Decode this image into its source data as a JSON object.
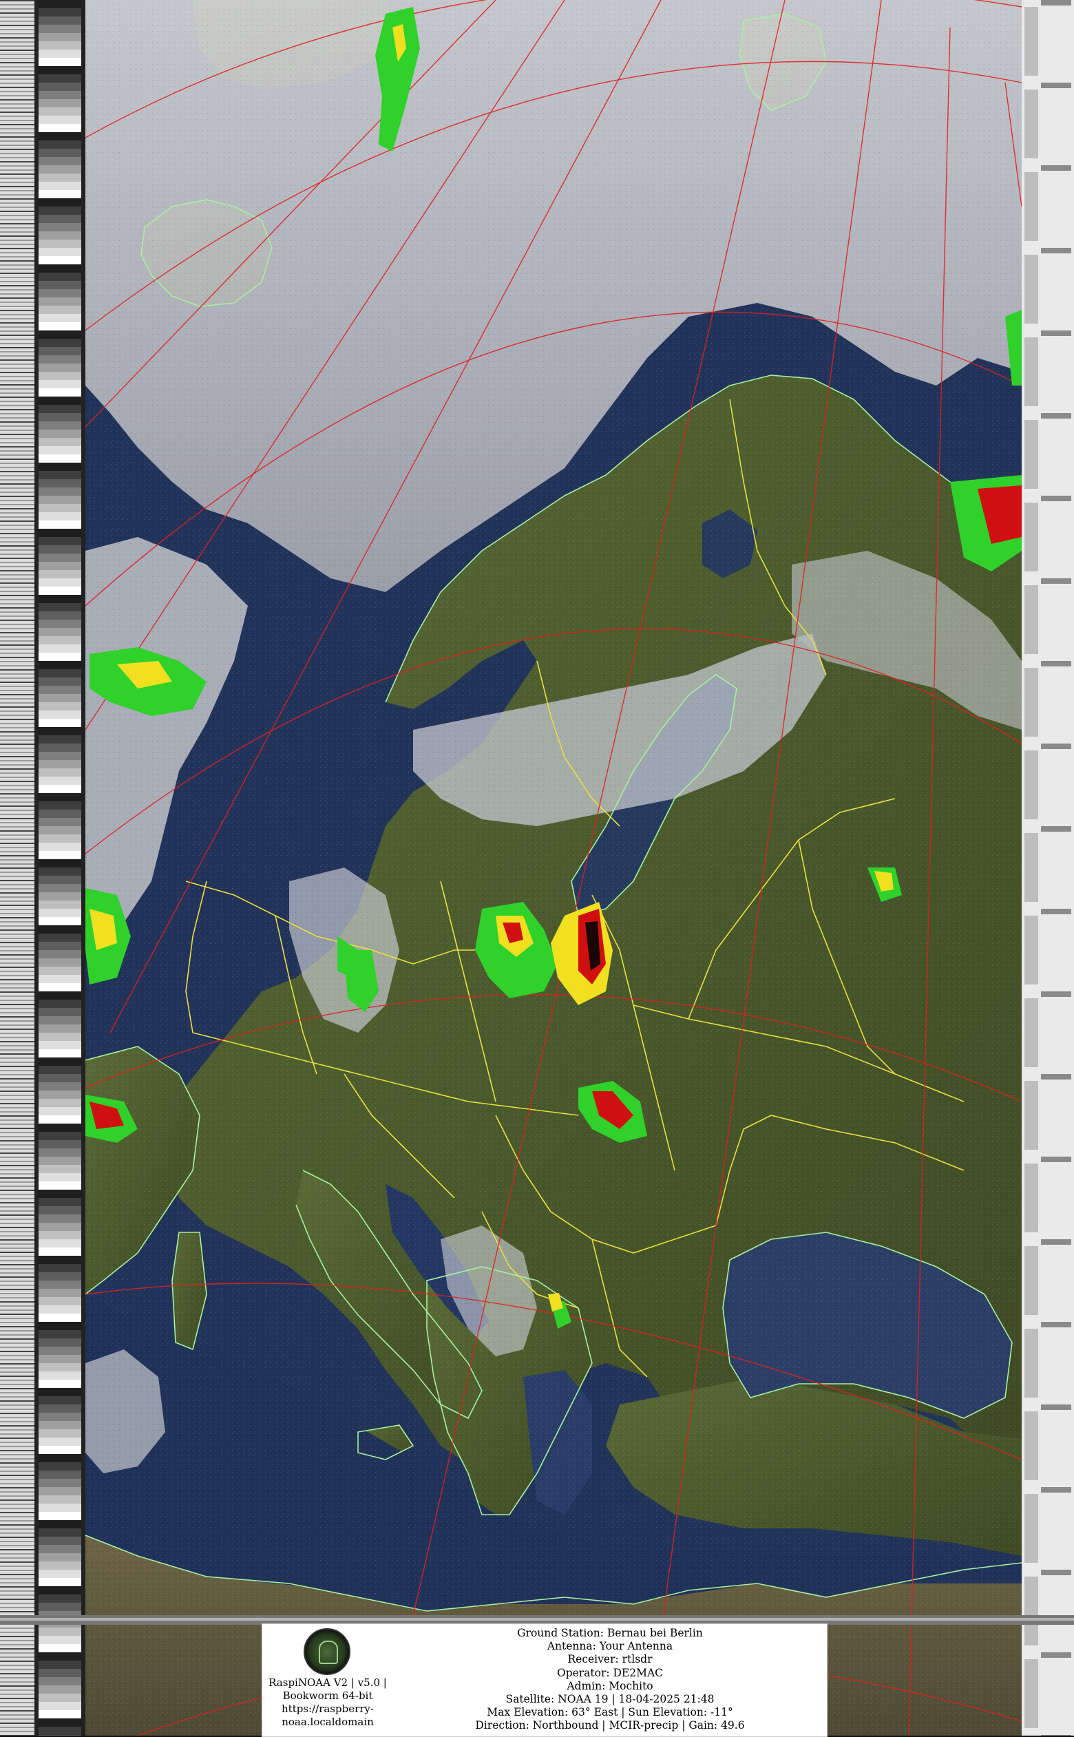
{
  "image": {
    "content": "NOAA satellite MCIR precipitation image over Europe with telemetry side bars",
    "palette": {
      "ocean": "#22335a",
      "land": "#4a5a2c",
      "cloud": "#c9ccd2",
      "coast": "#a8f0a0",
      "border": "#e8e040",
      "grid": "#e02020",
      "precip_green": "#2fd12a",
      "precip_yellow": "#f0e020",
      "precip_red": "#d01010"
    }
  },
  "caption": {
    "left_lines": [
      "RaspiNOAA V2 | v5.0 |",
      "Bookworm 64-bit",
      "https://raspberry-",
      "noaa.localdomain"
    ],
    "right_lines": [
      "Ground Station: Bernau bei Berlin",
      "Antenna: Your Antenna",
      "Receiver: rtlsdr",
      "Operator: DE2MAC",
      "Admin: Mochito",
      "Satellite: NOAA 19 | 18-04-2025 21:48",
      "Max Elevation: 63° East | Sun Elevation: -11°",
      "Direction: Northbound | MCIR-precip | Gain: 49.6"
    ]
  }
}
